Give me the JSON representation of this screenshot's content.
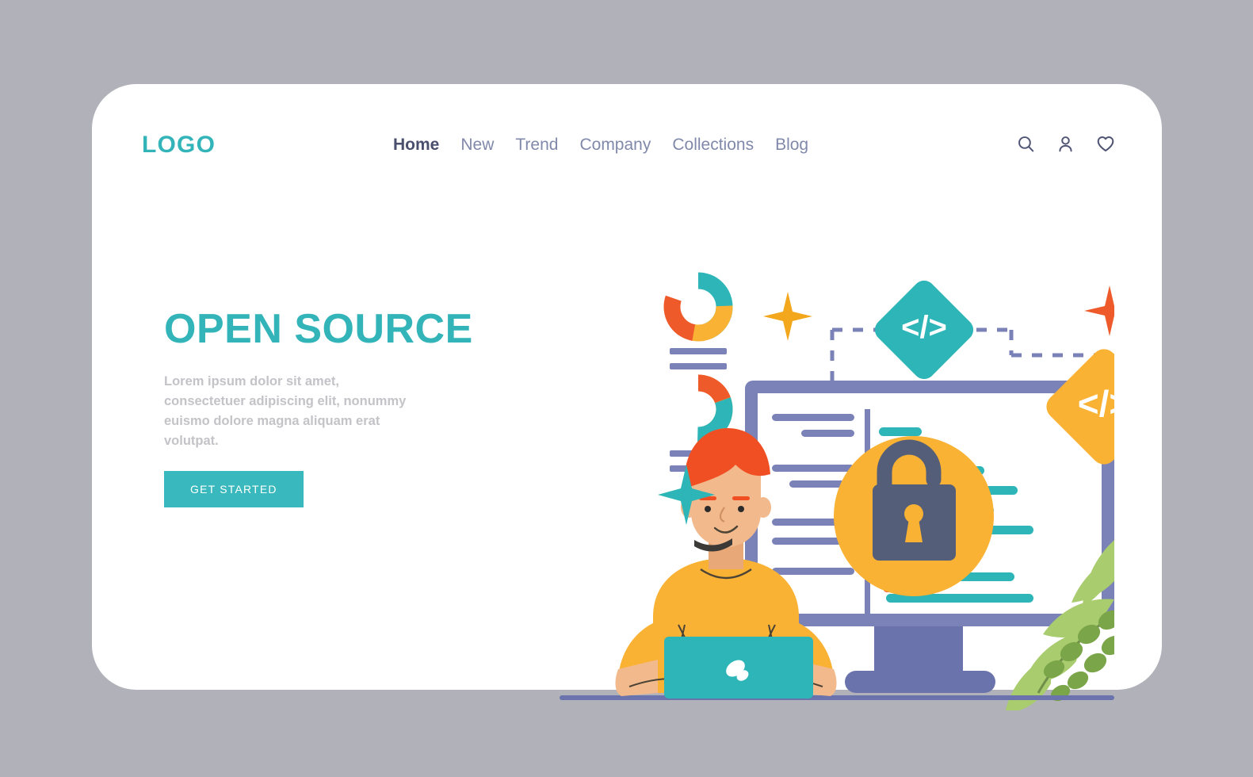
{
  "page": {
    "background_color": "#b1b1b9",
    "card_color": "#ffffff"
  },
  "header": {
    "logo": "LOGO",
    "nav": [
      {
        "label": "Home",
        "active": true
      },
      {
        "label": "New",
        "active": false
      },
      {
        "label": "Trend",
        "active": false
      },
      {
        "label": "Company",
        "active": false
      },
      {
        "label": "Collections",
        "active": false
      },
      {
        "label": "Blog",
        "active": false
      }
    ],
    "icons": [
      {
        "name": "search-icon"
      },
      {
        "name": "user-icon"
      },
      {
        "name": "heart-icon"
      }
    ]
  },
  "hero": {
    "title": "OPEN SOURCE",
    "body": "Lorem ipsum dolor sit amet, consectetuer adipiscing elit, nonummy euismo dolore magna aliquam erat volutpat.",
    "cta_label": "GET STARTED",
    "title_color": "#33b4b9",
    "cta_color": "#39b8bd"
  },
  "illustration": {
    "alt": "developer at laptop with monitor, open padlock and code diamonds",
    "code_symbol": "</>",
    "colors": {
      "teal": "#2eb5b8",
      "yellow": "#f9b233",
      "orange_red": "#ef5a2a",
      "purple": "#7b82b8",
      "slate": "#555e78",
      "skin": "#f2b98c",
      "hair": "#f04e23",
      "green": "#a9cc6e",
      "green_dark": "#7ba549"
    }
  }
}
